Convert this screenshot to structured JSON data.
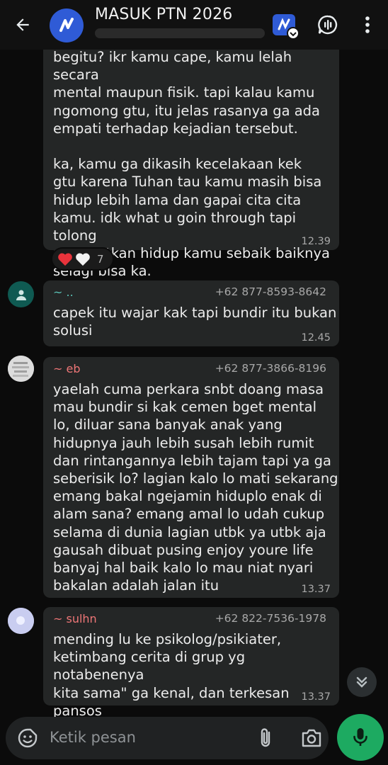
{
  "header": {
    "title": "MASUK PTN 2026",
    "icons": [
      "back-arrow-icon",
      "group-avatar",
      "app-badge-icon",
      "voice-chat-icon",
      "more-vert-icon"
    ]
  },
  "messages": [
    {
      "text": "begitu? ikr kamu cape, kamu lelah secara\nmental maupun fisik. tapi kalau kamu\nngomong gtu, itu jelas rasanya ga ada\nempati terhadap kejadian tersebut.\n\nka, kamu ga dikasih kecelakaan kek\ngtu karena Tuhan tau kamu masih bisa\nhidup lebih lama dan gapai cita cita\nkamu. idk what u goin through tapi tolong\nmanfaatkan hidup kamu sebaik baiknya\nselagi bisa ka.",
      "time": "12.39",
      "reactions": {
        "emoji": [
          "❤️",
          "🤍"
        ],
        "count": "7"
      }
    },
    {
      "sender": "~ ..",
      "phone": "+62 877-8593-8642",
      "text": "capek itu wajar kak tapi bundir itu bukan\nsolusi",
      "time": "12.45"
    },
    {
      "sender": "~ eb",
      "phone": "+62 877-3866-8196",
      "text": "yaelah cuma perkara snbt doang masa\nmau bundir si kak cemen bget mental\nlo, diluar sana banyak anak yang\nhidupnya jauh lebih susah lebih rumit\ndan rintangannya lebih tajam tapi ya ga\nseberisik lo? lagian kalo lo mati sekarang\nemang bakal ngejamin hiduplo enak di\nalam sana? emang amal lo udah cukup\nselama di dunia lagian utbk ya utbk aja\ngausah dibuat pusing enjoy youre life\nbanyaj hal baik kalo lo mau niat nyari\nbakalan adalah jalan itu",
      "time": "13.37"
    },
    {
      "sender": "~ sulhn",
      "phone": "+62 822-7536-1978",
      "text": "mending lu ke psikolog/psikiater,\nketimbang cerita di grup yg notabenenya\nkita sama\" ga kenal, dan terkesan pansos",
      "time": "13.37"
    }
  ],
  "input": {
    "placeholder": "Ketik pesan",
    "icons": [
      "emoji-icon",
      "attach-icon",
      "camera-icon",
      "mic-icon"
    ]
  },
  "colors": {
    "header_bg": "#111111",
    "bubble_bg": "#242626",
    "sender_green": "#5bc4b8",
    "sender_pink": "#ee7677",
    "accent_green": "#1daa61",
    "brand_blue": "#2f5bd6"
  }
}
